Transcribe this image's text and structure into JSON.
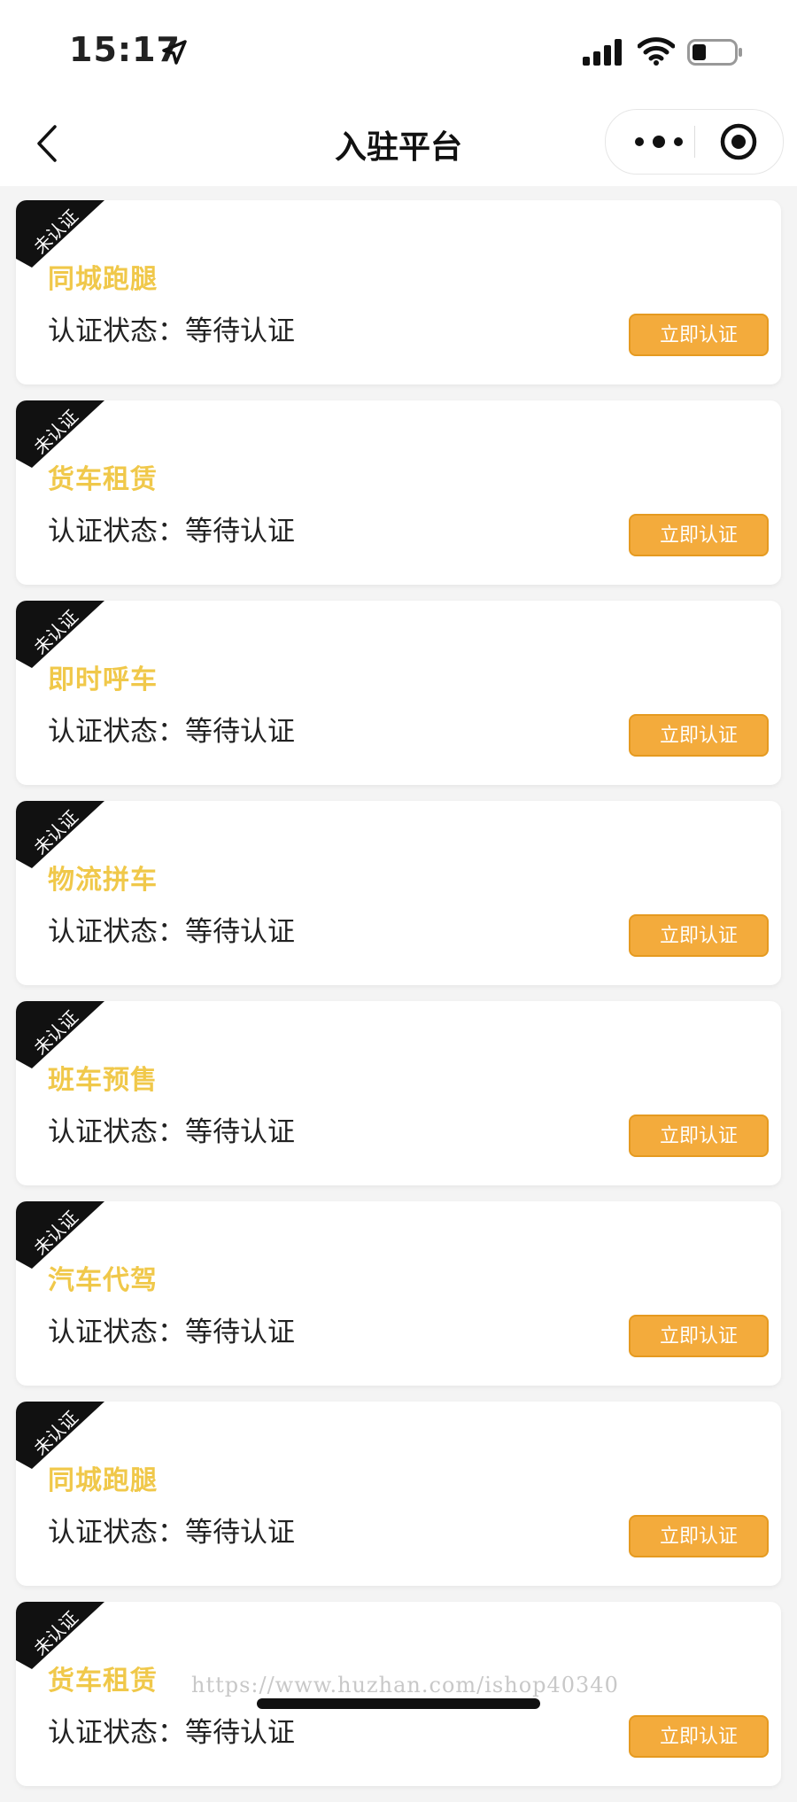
{
  "status_bar": {
    "time": "15:17"
  },
  "navbar": {
    "title": "入驻平台"
  },
  "cards": [
    {
      "badge": "未认证",
      "title": "同城跑腿",
      "status": "认证状态：等待认证",
      "button": "立即认证"
    },
    {
      "badge": "未认证",
      "title": "货车租赁",
      "status": "认证状态：等待认证",
      "button": "立即认证"
    },
    {
      "badge": "未认证",
      "title": "即时呼车",
      "status": "认证状态：等待认证",
      "button": "立即认证"
    },
    {
      "badge": "未认证",
      "title": "物流拼车",
      "status": "认证状态：等待认证",
      "button": "立即认证"
    },
    {
      "badge": "未认证",
      "title": "班车预售",
      "status": "认证状态：等待认证",
      "button": "立即认证"
    },
    {
      "badge": "未认证",
      "title": "汽车代驾",
      "status": "认证状态：等待认证",
      "button": "立即认证"
    },
    {
      "badge": "未认证",
      "title": "同城跑腿",
      "status": "认证状态：等待认证",
      "button": "立即认证"
    },
    {
      "badge": "未认证",
      "title": "货车租赁",
      "status": "认证状态：等待认证",
      "button": "立即认证"
    }
  ],
  "watermark": "https://www.huzhan.com/ishop40340",
  "colors": {
    "accent": "#f3ab3c",
    "title": "#f0c84a",
    "badge": "#111111"
  },
  "icons": [
    "location-arrow-icon",
    "cellular-signal-icon",
    "wifi-icon",
    "battery-icon",
    "back-chevron-icon",
    "more-dots-icon",
    "record-target-icon"
  ]
}
